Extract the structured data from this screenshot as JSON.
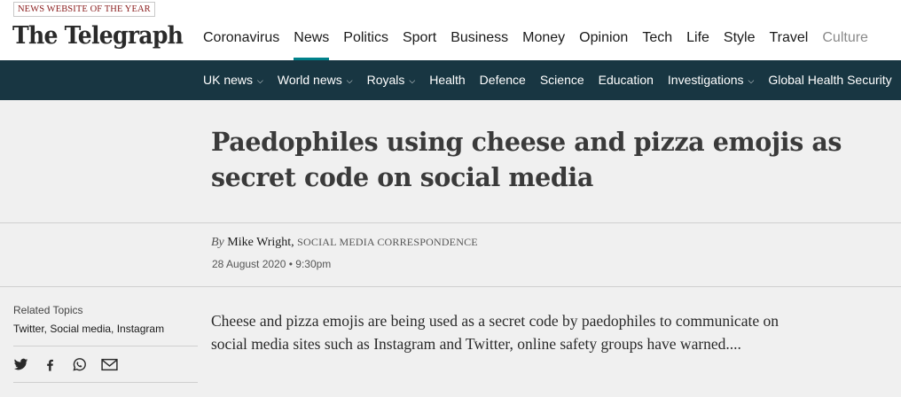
{
  "header": {
    "award_badge": "NEWS WEBSITE OF THE YEAR",
    "logo_text": "The Telegraph",
    "primary_nav": [
      {
        "label": "Coronavirus"
      },
      {
        "label": "News",
        "active": true
      },
      {
        "label": "Politics"
      },
      {
        "label": "Sport"
      },
      {
        "label": "Business"
      },
      {
        "label": "Money"
      },
      {
        "label": "Opinion"
      },
      {
        "label": "Tech"
      },
      {
        "label": "Life"
      },
      {
        "label": "Style"
      },
      {
        "label": "Travel"
      },
      {
        "label": "Culture"
      }
    ]
  },
  "sub_nav": [
    {
      "label": "UK news",
      "has_dropdown": true
    },
    {
      "label": "World news",
      "has_dropdown": true
    },
    {
      "label": "Royals",
      "has_dropdown": true
    },
    {
      "label": "Health"
    },
    {
      "label": "Defence"
    },
    {
      "label": "Science"
    },
    {
      "label": "Education"
    },
    {
      "label": "Investigations",
      "has_dropdown": true
    },
    {
      "label": "Global Health Security"
    }
  ],
  "article": {
    "headline": "Paedophiles using cheese and pizza emojis as secret code on social media",
    "byline_prefix": "By",
    "author": "Mike Wright,",
    "author_role": "SOCIAL MEDIA CORRESPONDENCE",
    "dateline": "28 August 2020 • 9:30pm",
    "body": "Cheese and pizza emojis are being used as a secret code by paedophiles to communicate on social media sites such as Instagram and Twitter, online safety groups have warned...."
  },
  "sidebar": {
    "related_title": "Related Topics",
    "related_topics": "Twitter, Social media, Instagram",
    "share_icons": [
      "twitter-icon",
      "facebook-icon",
      "whatsapp-icon",
      "email-icon"
    ]
  },
  "colors": {
    "brand_dark": "#183642",
    "active_tab": "#00818a",
    "award_text": "#8a1d1d"
  }
}
